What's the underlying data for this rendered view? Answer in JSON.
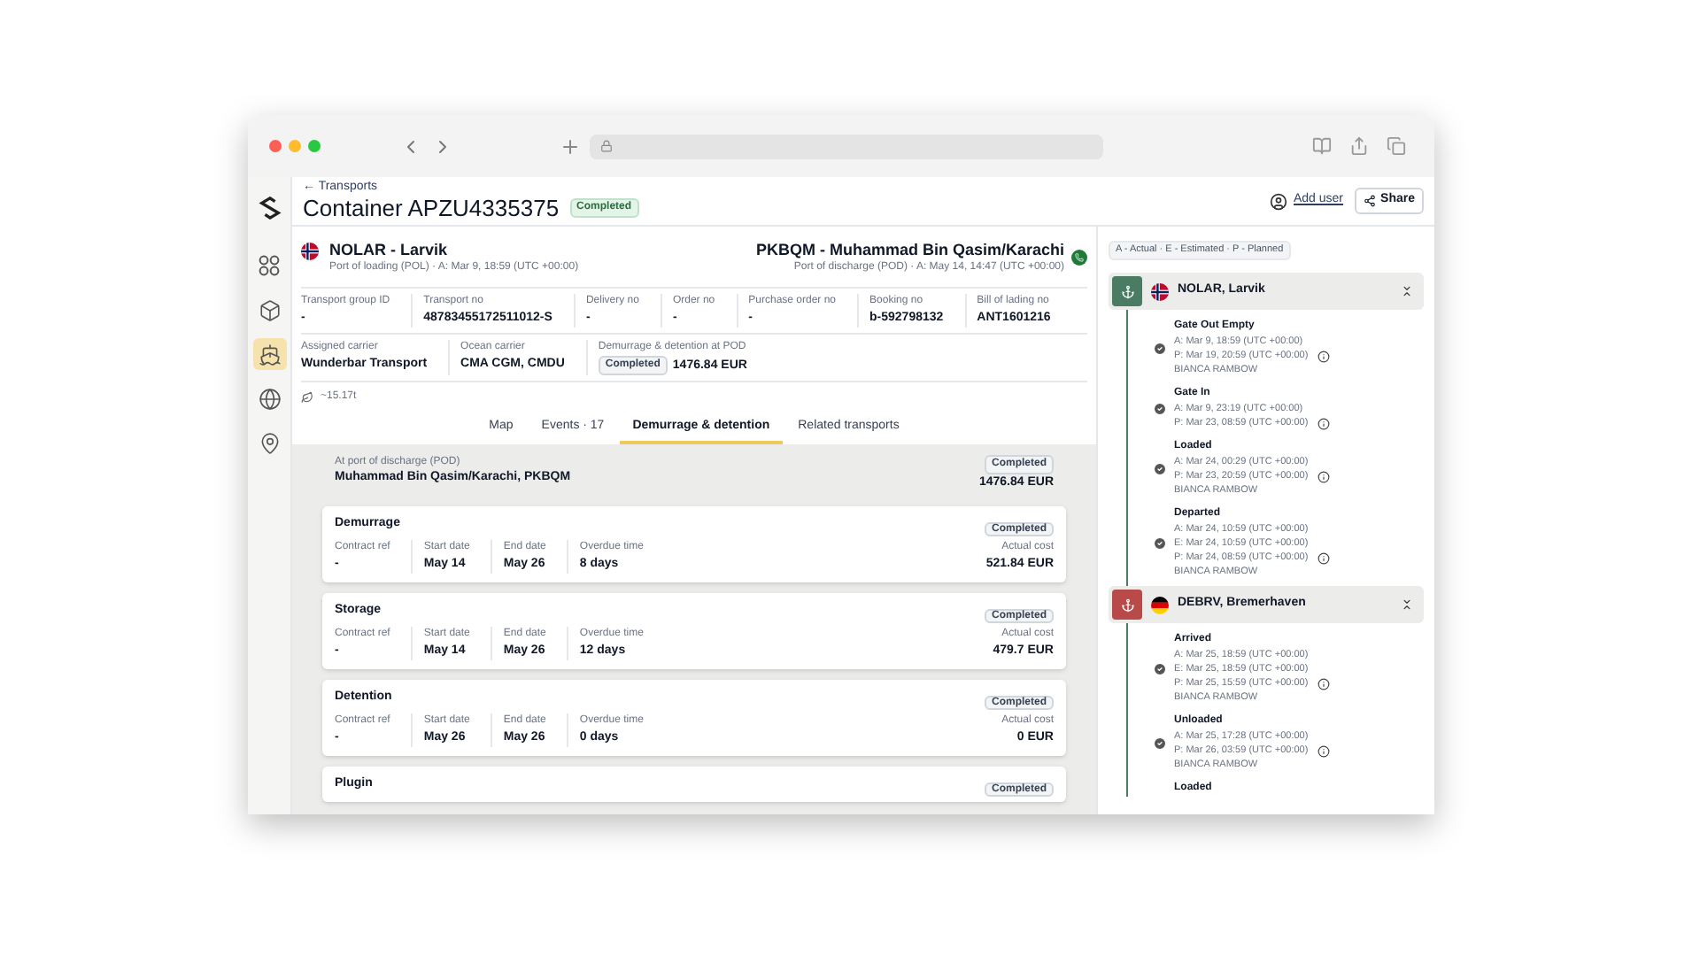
{
  "rail": [
    {
      "selected": false
    },
    {
      "selected": false
    },
    {
      "selected": false
    },
    {
      "selected": true
    },
    {
      "selected": false
    },
    {
      "selected": false
    }
  ],
  "header": {
    "back": "← Transports",
    "title": "Container APZU4335375",
    "status": "Completed",
    "add_user": "Add user",
    "share": "Share"
  },
  "route": {
    "origin": {
      "name": "NOLAR - Larvik",
      "detail": "Port of loading (POL) · A: Mar 9, 18:59 (UTC +00:00)"
    },
    "destination": {
      "name": "PKBQM - Muhammad Bin Qasim/Karachi",
      "detail": "Port of discharge (POD) · A: May 14, 14:47 (UTC +00:00)"
    }
  },
  "fields_row_1": [
    {
      "label": "Transport group ID",
      "value": "-"
    },
    {
      "label": "Transport no",
      "value": "48783455172511012-S"
    },
    {
      "label": "Delivery no",
      "value": "-"
    },
    {
      "label": "Order no",
      "value": "-"
    },
    {
      "label": "Purchase order no",
      "value": "-"
    },
    {
      "label": "Booking no",
      "value": "b-592798132"
    },
    {
      "label": "Bill of lading no",
      "value": "ANT1601216"
    }
  ],
  "fields_row_2": [
    {
      "label": "Assigned carrier",
      "value": "Wunderbar Transport"
    },
    {
      "label": "Ocean carrier",
      "value": "CMA CGM, CMDU"
    },
    {
      "label": "Demurrage & detention at POD",
      "badge": "Completed",
      "value": "1476.84 EUR"
    }
  ],
  "emissions": "~15.17t",
  "tabs": [
    {
      "label": "Map",
      "selected": false
    },
    {
      "label": "Events · 17",
      "selected": false
    },
    {
      "label": "Demurrage & detention",
      "selected": true
    },
    {
      "label": "Related transports",
      "selected": false
    }
  ],
  "summary": {
    "label": "At port of discharge (POD)",
    "place": "Muhammad Bin Qasim/Karachi, PKBQM",
    "status": "Completed",
    "total": "1476.84 EUR"
  },
  "charges": [
    {
      "title": "Demurrage",
      "status": "Completed",
      "fields": [
        {
          "label": "Contract ref",
          "value": "-"
        },
        {
          "label": "Start date",
          "value": "May 14"
        },
        {
          "label": "End date",
          "value": "May 26"
        },
        {
          "label": "Overdue time",
          "value": "8 days"
        }
      ],
      "cost_label": "Actual cost",
      "cost": "521.84 EUR"
    },
    {
      "title": "Storage",
      "status": "Completed",
      "fields": [
        {
          "label": "Contract ref",
          "value": "-"
        },
        {
          "label": "Start date",
          "value": "May 14"
        },
        {
          "label": "End date",
          "value": "May 26"
        },
        {
          "label": "Overdue time",
          "value": "12 days"
        }
      ],
      "cost_label": "Actual cost",
      "cost": "479.7 EUR"
    },
    {
      "title": "Detention",
      "status": "Completed",
      "fields": [
        {
          "label": "Contract ref",
          "value": "-"
        },
        {
          "label": "Start date",
          "value": "May 26"
        },
        {
          "label": "End date",
          "value": "May 26"
        },
        {
          "label": "Overdue time",
          "value": "0 days"
        }
      ],
      "cost_label": "Actual cost",
      "cost": "0 EUR"
    },
    {
      "title": "Plugin",
      "status": "Completed"
    }
  ],
  "legend": "A - Actual · E - Estimated · P - Planned",
  "stations": [
    {
      "name": "NOLAR, Larvik",
      "color": "#4a7c63",
      "events": [
        {
          "title": "Gate Out Empty",
          "lines": [
            "A: Mar 9, 18:59 (UTC +00:00)",
            "P: Mar 19, 20:59 (UTC +00:00)"
          ],
          "by": "BIANCA RAMBOW"
        },
        {
          "title": "Gate In",
          "lines": [
            "A: Mar 9, 23:19 (UTC +00:00)",
            "P: Mar 23, 08:59 (UTC +00:00)"
          ]
        },
        {
          "title": "Loaded",
          "lines": [
            "A: Mar 24, 00:29 (UTC +00:00)",
            "P: Mar 23, 20:59 (UTC +00:00)"
          ],
          "by": "BIANCA RAMBOW"
        },
        {
          "title": "Departed",
          "lines": [
            "A: Mar 24, 10:59 (UTC +00:00)",
            "E: Mar 24, 10:59 (UTC +00:00)",
            "P: Mar 24, 08:59 (UTC +00:00)"
          ],
          "by": "BIANCA RAMBOW"
        }
      ]
    },
    {
      "name": "DEBRV, Bremerhaven",
      "color": "#b94a4a",
      "events": [
        {
          "title": "Arrived",
          "lines": [
            "A: Mar 25, 18:59 (UTC +00:00)",
            "E: Mar 25, 18:59 (UTC +00:00)",
            "P: Mar 25, 15:59 (UTC +00:00)"
          ],
          "by": "BIANCA RAMBOW"
        },
        {
          "title": "Unloaded",
          "lines": [
            "A: Mar 25, 17:28 (UTC +00:00)",
            "P: Mar 26, 03:59 (UTC +00:00)"
          ],
          "by": "BIANCA RAMBOW"
        },
        {
          "title": "Loaded"
        }
      ]
    }
  ]
}
